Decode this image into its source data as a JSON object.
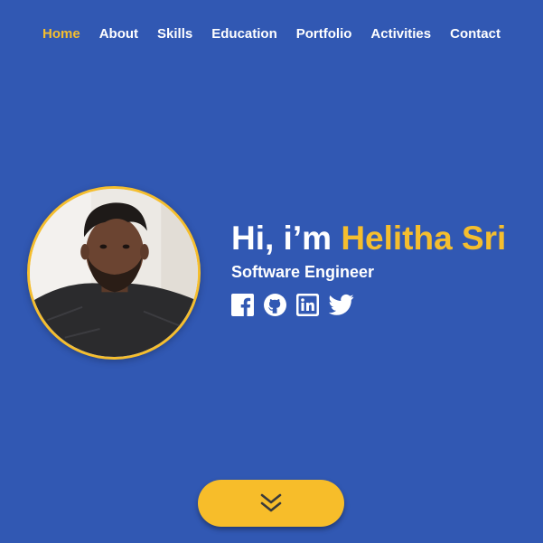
{
  "nav": {
    "items": [
      {
        "label": "Home",
        "active": true
      },
      {
        "label": "About"
      },
      {
        "label": "Skills"
      },
      {
        "label": "Education"
      },
      {
        "label": "Portfolio"
      },
      {
        "label": "Activities"
      },
      {
        "label": "Contact"
      }
    ]
  },
  "hero": {
    "greeting": "Hi, i’m",
    "name": "Helitha Sri",
    "role": "Software Engineer",
    "social": [
      "facebook-icon",
      "github-icon",
      "linkedin-icon",
      "twitter-icon"
    ]
  },
  "colors": {
    "background": "#3158b3",
    "accent": "#f5be2e",
    "text": "#ffffff"
  },
  "scroll_button": {
    "icon": "double-chevron-down-icon"
  }
}
